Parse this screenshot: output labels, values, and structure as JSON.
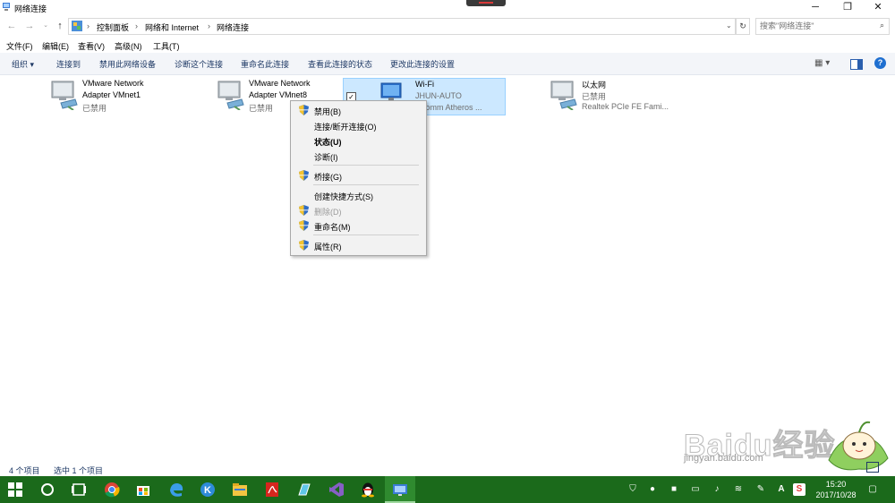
{
  "window": {
    "title": "网络连接",
    "controls": [
      "minimize-icon",
      "restore-icon",
      "close-icon"
    ]
  },
  "address": {
    "breadcrumb": [
      "控制面板",
      "网络和 Internet",
      "网络连接"
    ],
    "search_placeholder": "搜索\"网络连接\""
  },
  "menu": [
    "文件(F)",
    "编辑(E)",
    "查看(V)",
    "高级(N)",
    "工具(T)"
  ],
  "toolbar": {
    "organize": "组织",
    "items": [
      "连接到",
      "禁用此网络设备",
      "诊断这个连接",
      "重命名此连接",
      "查看此连接的状态",
      "更改此连接的设置"
    ]
  },
  "connections": [
    {
      "name1": "VMware Network",
      "name2": "Adapter VMnet1",
      "status": "已禁用",
      "selected": false
    },
    {
      "name1": "VMware Network",
      "name2": "Adapter VMnet8",
      "status": "已禁用",
      "selected": false
    },
    {
      "name1": "Wi-Fi",
      "name2": "JHUN-AUTO",
      "status": "Qualcomm Atheros ...",
      "visible_status": "alcomm Atheros ...",
      "selected": true
    },
    {
      "name1": "以太网",
      "name2": "已禁用",
      "status": "Realtek PCIe FE Fami...",
      "selected": false
    }
  ],
  "context_menu": {
    "items": [
      {
        "label": "禁用(B)",
        "shield": true,
        "bold": false,
        "disabled": false
      },
      {
        "label": "连接/断开连接(O)",
        "shield": false,
        "bold": false,
        "disabled": false
      },
      {
        "label": "状态(U)",
        "shield": false,
        "bold": true,
        "disabled": false
      },
      {
        "label": "诊断(I)",
        "shield": false,
        "bold": false,
        "disabled": false
      },
      {
        "label": "桥接(G)",
        "shield": true,
        "bold": false,
        "disabled": false
      },
      {
        "label": "创建快捷方式(S)",
        "shield": false,
        "bold": false,
        "disabled": false
      },
      {
        "label": "删除(D)",
        "shield": true,
        "bold": false,
        "disabled": true
      },
      {
        "label": "重命名(M)",
        "shield": true,
        "bold": false,
        "disabled": false
      },
      {
        "label": "属性(R)",
        "shield": true,
        "bold": false,
        "disabled": false
      }
    ]
  },
  "status_bar": {
    "count": "4 个项目",
    "selected": "选中 1 个项目"
  },
  "taskbar": {
    "apps": [
      "start-icon",
      "cortana-icon",
      "task-view-icon",
      "chrome-icon",
      "store-icon",
      "edge-icon",
      "k-app-icon",
      "file-explorer-icon",
      "acrobat-icon",
      "app-icon",
      "visual-studio-icon",
      "qq-icon",
      "network-window-icon"
    ],
    "tray_ime": "A",
    "time": "15:20",
    "date": "2017/10/28"
  },
  "watermark": {
    "line1": "Baidu经验",
    "line2": "jingyan.baidu.com"
  },
  "colors": {
    "taskbar": "#1b6a1b",
    "selection": "#cce8ff",
    "toolbar_text": "#1e3965"
  }
}
